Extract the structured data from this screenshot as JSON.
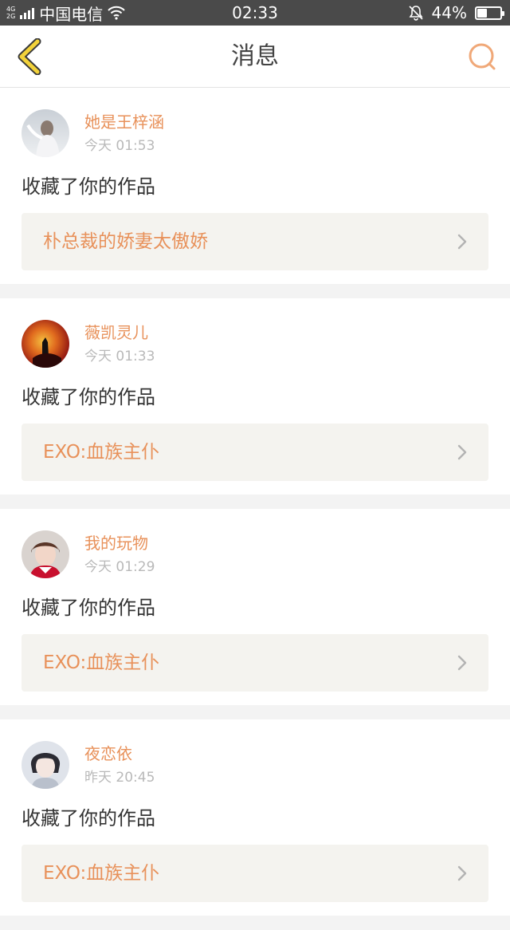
{
  "status_bar": {
    "net_top": "4G",
    "net_bottom": "2G",
    "carrier": "中国电信",
    "time": "02:33",
    "battery_percent": "44%",
    "battery_level": 0.44,
    "icons": [
      "signal-icon",
      "wifi-icon",
      "mute-bell-icon",
      "battery-icon"
    ]
  },
  "nav": {
    "title": "消息",
    "back_icon": "back-chevron-icon",
    "search_icon": "search-icon",
    "accent_color": "#e8915a",
    "back_color": "#f2d23a"
  },
  "messages": [
    {
      "user": "她是王梓涵",
      "time": "今天 01:53",
      "action": "收藏了你的作品",
      "work": "朴总裁的娇妻太傲娇"
    },
    {
      "user": "薇凯灵儿",
      "time": "今天 01:33",
      "action": "收藏了你的作品",
      "work": "EXO:血族主仆"
    },
    {
      "user": "我的玩物",
      "time": "今天 01:29",
      "action": "收藏了你的作品",
      "work": "EXO:血族主仆"
    },
    {
      "user": "夜恋依",
      "time": "昨天 20:45",
      "action": "收藏了你的作品",
      "work": "EXO:血族主仆"
    }
  ]
}
